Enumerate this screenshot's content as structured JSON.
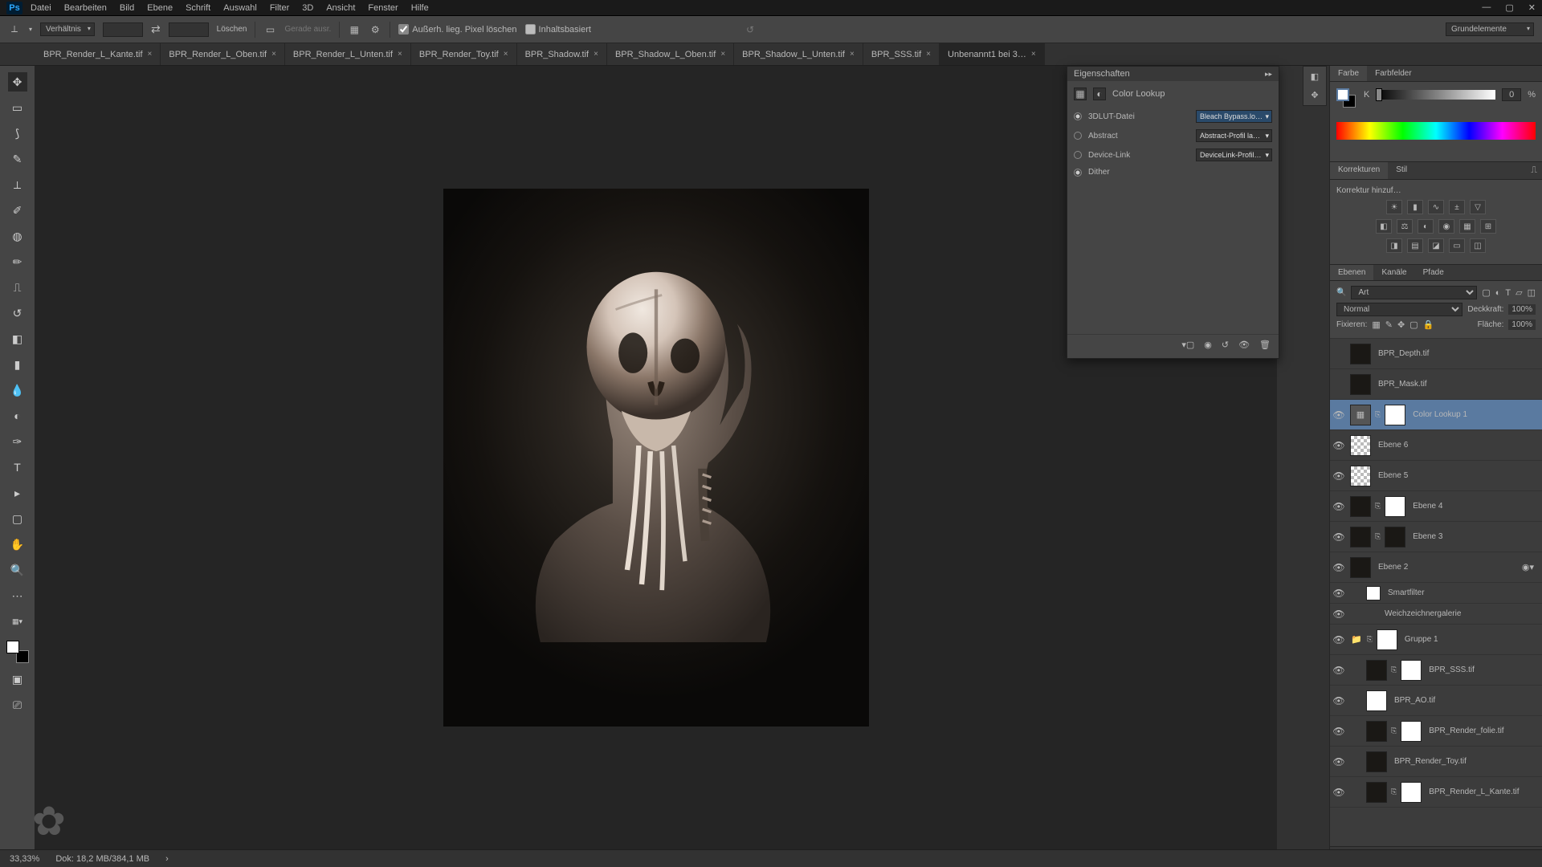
{
  "menu": {
    "items": [
      "Datei",
      "Bearbeiten",
      "Bild",
      "Ebene",
      "Schrift",
      "Auswahl",
      "Filter",
      "3D",
      "Ansicht",
      "Fenster",
      "Hilfe"
    ]
  },
  "optbar": {
    "ratio_label": "Verhältnis",
    "clear": "Löschen",
    "straighten": "Gerade ausr.",
    "delete_cropped": "Außerh. lieg. Pixel löschen",
    "content_aware": "Inhaltsbasiert",
    "workspace": "Grundelemente"
  },
  "tabs": [
    {
      "label": "BPR_Render_L_Kante.tif",
      "active": false
    },
    {
      "label": "BPR_Render_L_Oben.tif",
      "active": false
    },
    {
      "label": "BPR_Render_L_Unten.tif",
      "active": false
    },
    {
      "label": "BPR_Render_Toy.tif",
      "active": false
    },
    {
      "label": "BPR_Shadow.tif",
      "active": false
    },
    {
      "label": "BPR_Shadow_L_Oben.tif",
      "active": false
    },
    {
      "label": "BPR_Shadow_L_Unten.tif",
      "active": false
    },
    {
      "label": "BPR_SSS.tif",
      "active": false
    },
    {
      "label": "Unbenannt1 bei 3…",
      "active": true
    }
  ],
  "properties": {
    "title": "Eigenschaften",
    "subtitle": "Color Lookup",
    "rows": [
      {
        "label": "3DLUT-Datei",
        "value": "Bleach Bypass.lo…",
        "on": true,
        "hl": true
      },
      {
        "label": "Abstract",
        "value": "Abstract-Profil la…",
        "on": false,
        "hl": false
      },
      {
        "label": "Device-Link",
        "value": "DeviceLink-Profil…",
        "on": false,
        "hl": false
      },
      {
        "label": "Dither",
        "value": "",
        "on": true,
        "hl": false
      }
    ]
  },
  "color": {
    "tab1": "Farbe",
    "tab2": "Farbfelder",
    "k": "K",
    "val": "0",
    "pct": "%"
  },
  "corrections": {
    "tab1": "Korrekturen",
    "tab2": "Stil",
    "hint": "Korrektur hinzuf…"
  },
  "layers": {
    "tab1": "Ebenen",
    "tab2": "Kanäle",
    "tab3": "Pfade",
    "filter": "Art",
    "blend": "Normal",
    "opacity_lbl": "Deckkraft:",
    "opacity": "100%",
    "lock_lbl": "Fixieren:",
    "fill_lbl": "Fläche:",
    "fill": "100%",
    "items": [
      {
        "vis": false,
        "name": "BPR_Depth.tif",
        "thumb": "dark",
        "mask": false,
        "indent": 0
      },
      {
        "vis": false,
        "name": "BPR_Mask.tif",
        "thumb": "dark",
        "mask": false,
        "indent": 0
      },
      {
        "vis": true,
        "name": "Color Lookup 1",
        "thumb": "grid",
        "mask": true,
        "sel": true,
        "adj": true,
        "indent": 0
      },
      {
        "vis": true,
        "name": "Ebene 6",
        "thumb": "empty",
        "mask": false,
        "indent": 0
      },
      {
        "vis": true,
        "name": "Ebene 5",
        "thumb": "empty",
        "mask": false,
        "indent": 0
      },
      {
        "vis": true,
        "name": "Ebene 4",
        "thumb": "dark",
        "mask": true,
        "indent": 0
      },
      {
        "vis": true,
        "name": "Ebene 3",
        "thumb": "dark",
        "mask": true,
        "maskdark": true,
        "indent": 0
      },
      {
        "vis": true,
        "name": "Ebene 2",
        "thumb": "dark",
        "mask": false,
        "smart": true,
        "indent": 0
      },
      {
        "vis": true,
        "name": "Smartfilter",
        "thumb": "mask",
        "mask": false,
        "indent": 1,
        "small": true
      },
      {
        "vis": true,
        "name": "Weichzeichnergalerie",
        "thumb": "",
        "mask": false,
        "indent": 2,
        "small": true
      },
      {
        "vis": true,
        "name": "Gruppe 1",
        "thumb": "folder",
        "mask": true,
        "indent": 0
      },
      {
        "vis": true,
        "name": "BPR_SSS.tif",
        "thumb": "dark",
        "mask": true,
        "indent": 1
      },
      {
        "vis": true,
        "name": "BPR_AO.tif",
        "thumb": "mask",
        "mask": false,
        "indent": 1
      },
      {
        "vis": true,
        "name": "BPR_Render_folie.tif",
        "thumb": "dark",
        "mask": true,
        "indent": 1
      },
      {
        "vis": true,
        "name": "BPR_Render_Toy.tif",
        "thumb": "dark",
        "mask": false,
        "indent": 1
      },
      {
        "vis": true,
        "name": "BPR_Render_L_Kante.tif",
        "thumb": "dark",
        "mask": true,
        "indent": 1
      }
    ]
  },
  "status": {
    "zoom": "33,33%",
    "doc": "Dok: 18,2 MB/384,1 MB"
  }
}
